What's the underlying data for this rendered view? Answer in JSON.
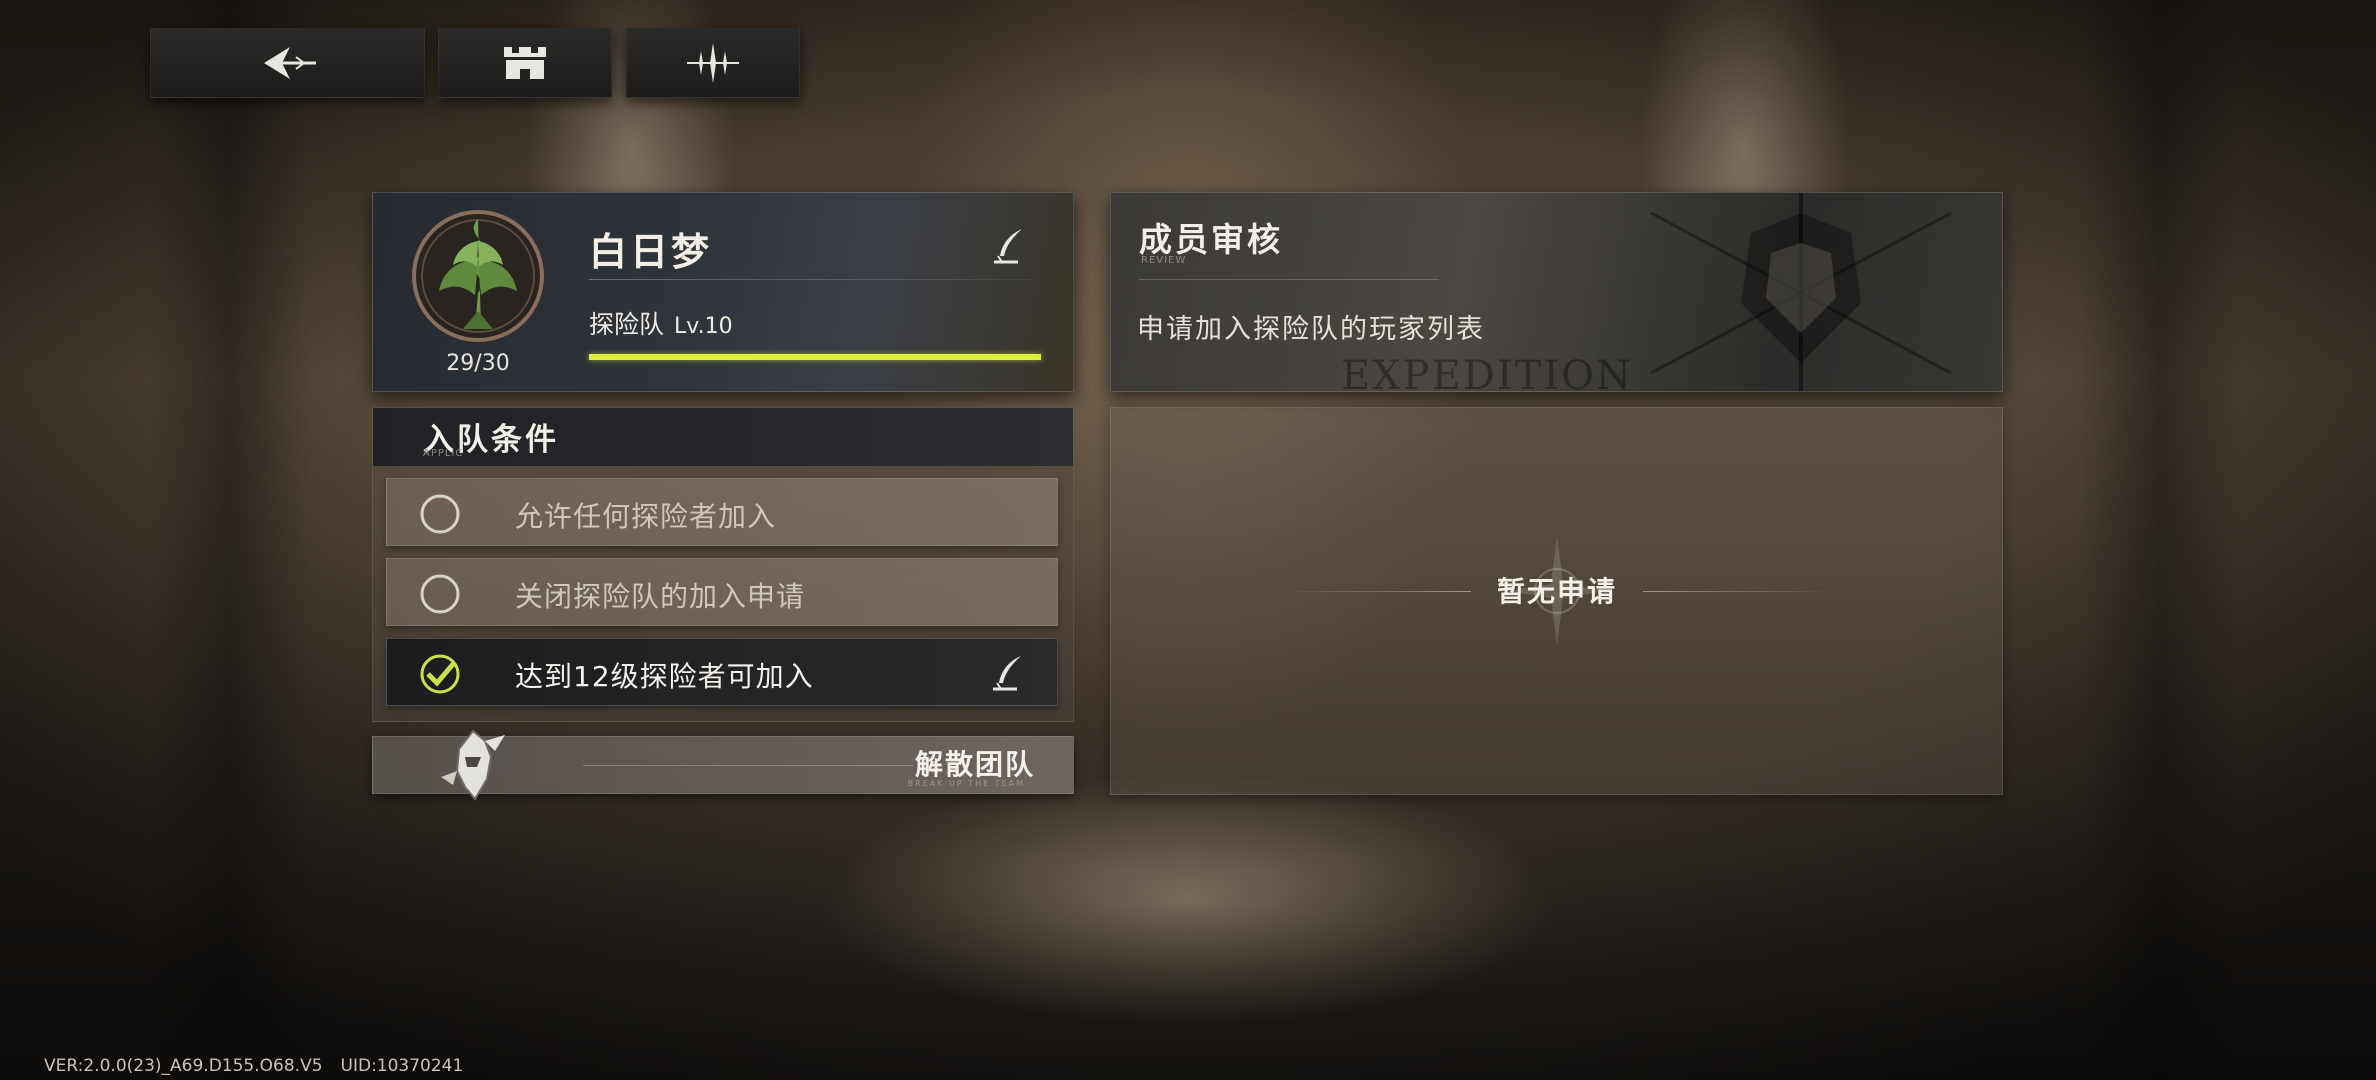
{
  "nav": {
    "back_icon": "back-arrow-icon",
    "castle_icon": "castle-icon",
    "sparkle_icon": "sparkle-icon"
  },
  "team": {
    "name": "白日梦",
    "member_count": "29/30",
    "level_label": "探险队",
    "level_value": "Lv.10",
    "xp_fraction": 1.0,
    "emblem_icon": "tree-emblem-icon",
    "edit_icon": "quill-icon"
  },
  "conditions": {
    "title": "入队条件",
    "subtitle": "APPLIC",
    "options": [
      {
        "label": "允许任何探险者加入",
        "selected": false
      },
      {
        "label": "关闭探险队的加入申请",
        "selected": false
      },
      {
        "label": "达到12级探险者可加入",
        "selected": true
      }
    ]
  },
  "disband": {
    "label": "解散团队",
    "subtitle": "BREAK UP THE TEAM",
    "icon": "helmet-icon"
  },
  "review": {
    "title": "成员审核",
    "subtitle": "REVIEW",
    "description": "申请加入探险队的玩家列表",
    "watermark": "EXPEDITION",
    "empty_text": "暂无申请"
  },
  "footer": {
    "version": "VER:2.0.0(23)_A69.D155.O68.V5",
    "uid": "UID:10370241"
  },
  "colors": {
    "accent_xp": "#dff03a",
    "check_green": "#c9e24a"
  }
}
